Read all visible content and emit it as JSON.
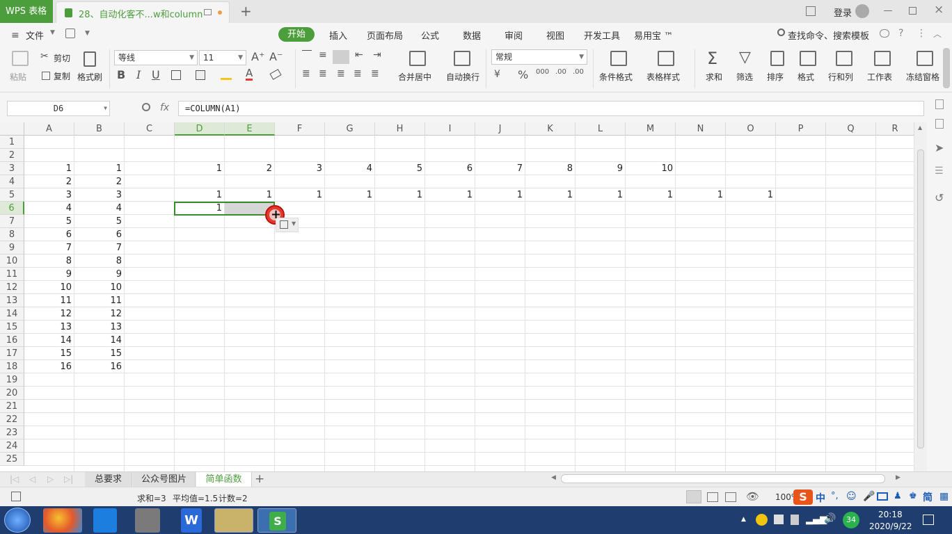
{
  "titlebar": {
    "app_name": "WPS 表格",
    "doc_tab": "28、自动化客不...w和column",
    "login": "登录",
    "new_tab": "+"
  },
  "menubar": {
    "file": "文件",
    "tabs": [
      "开始",
      "插入",
      "页面布局",
      "公式",
      "数据",
      "审阅",
      "视图",
      "开发工具",
      "易用宝 ™"
    ],
    "search": "查找命令、搜索模板"
  },
  "ribbon": {
    "paste": "粘贴",
    "cut": "剪切",
    "copy": "复制",
    "format_painter": "格式刷",
    "font_name": "等线",
    "font_size": "11",
    "number_format": "常规",
    "merge_center": "合并居中",
    "wrap_text": "自动换行",
    "cond_format": "条件格式",
    "table_style": "表格样式",
    "sum": "求和",
    "filter": "筛选",
    "sort": "排序",
    "format": "格式",
    "row_col": "行和列",
    "worksheet": "工作表",
    "freeze": "冻结窗格"
  },
  "formula_bar": {
    "name_box": "D6",
    "fx": "fx",
    "formula": "=COLUMN(A1)"
  },
  "grid": {
    "columns": [
      "A",
      "B",
      "C",
      "D",
      "E",
      "F",
      "G",
      "H",
      "I",
      "J",
      "K",
      "L",
      "M",
      "N",
      "O",
      "P",
      "Q",
      "R"
    ],
    "rows": [
      "1",
      "2",
      "3",
      "4",
      "5",
      "6",
      "7",
      "8",
      "9",
      "10",
      "11",
      "12",
      "13",
      "14",
      "15",
      "16",
      "17",
      "18",
      "19",
      "20",
      "21",
      "22",
      "23",
      "24",
      "25"
    ],
    "colA": [
      "1",
      "2",
      "3",
      "4",
      "5",
      "6",
      "7",
      "8",
      "9",
      "10",
      "11",
      "12",
      "13",
      "14",
      "15",
      "16"
    ],
    "colB": [
      "1",
      "2",
      "3",
      "4",
      "5",
      "6",
      "7",
      "8",
      "9",
      "10",
      "11",
      "12",
      "13",
      "14",
      "15",
      "16"
    ],
    "row3": [
      "1",
      "2",
      "3",
      "4",
      "5",
      "6",
      "7",
      "8",
      "9",
      "10"
    ],
    "row5": [
      "1",
      "1",
      "1",
      "1",
      "1",
      "1",
      "1",
      "1",
      "1",
      "1",
      "1",
      "1"
    ],
    "d6": "1",
    "selected_cell": "D6"
  },
  "sheets": {
    "tabs": [
      "总要求",
      "公众号图片",
      "简单函数"
    ],
    "active": "简单函数",
    "add": "+"
  },
  "statusbar": {
    "sum": "求和=3",
    "avg": "平均值=1.5",
    "count": "计数=2",
    "zoom": "100%"
  },
  "taskbar": {
    "time": "20:18",
    "date": "2020/9/22",
    "ime": "中",
    "notify_count": "34",
    "ime_mode": "简"
  }
}
